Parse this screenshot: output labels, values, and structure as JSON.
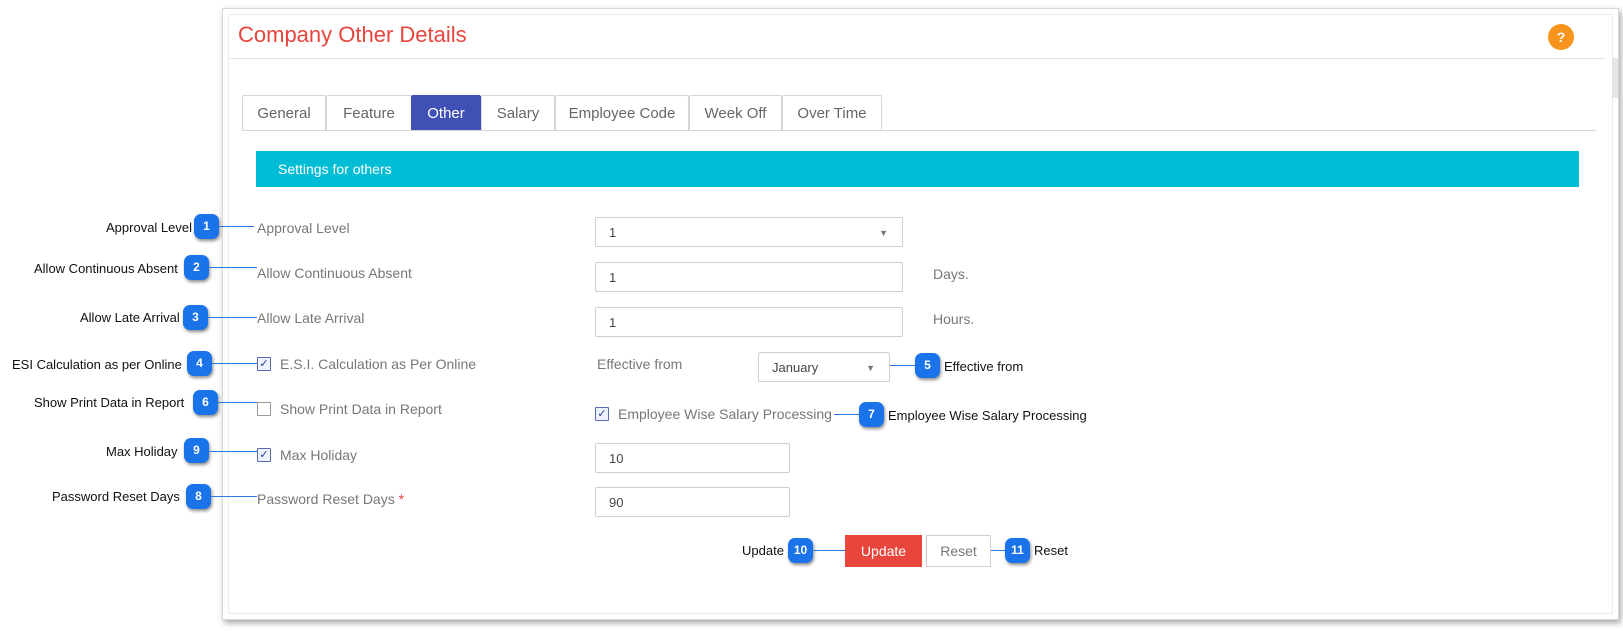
{
  "page": {
    "title": "Company Other Details",
    "help_label": "?"
  },
  "tabs": [
    {
      "label": "General",
      "active": false
    },
    {
      "label": "Feature",
      "active": false
    },
    {
      "label": "Other",
      "active": true
    },
    {
      "label": "Salary",
      "active": false
    },
    {
      "label": "Employee Code",
      "active": false
    },
    {
      "label": "Week Off",
      "active": false
    },
    {
      "label": "Over Time",
      "active": false
    }
  ],
  "section": {
    "title": "Settings for others"
  },
  "form": {
    "approval_level": {
      "label": "Approval Level",
      "value": "1"
    },
    "continuous_absent": {
      "label": "Allow Continuous Absent",
      "value": "1",
      "unit": "Days."
    },
    "late_arrival": {
      "label": "Allow Late Arrival",
      "value": "1",
      "unit": "Hours."
    },
    "esi": {
      "label": "E.S.I. Calculation as Per Online",
      "checked": true
    },
    "effective_from": {
      "label": "Effective from",
      "value": "January"
    },
    "show_print": {
      "label": "Show Print Data in Report",
      "checked": false
    },
    "employee_wise_salary": {
      "label": "Employee Wise Salary Processing",
      "checked": true
    },
    "max_holiday": {
      "label": "Max Holiday",
      "checked": true,
      "value": "10"
    },
    "password_reset_days": {
      "label": "Password Reset Days",
      "required_mark": "*",
      "value": "90"
    },
    "update_label": "Update",
    "reset_label": "Reset",
    "check_glyph": "✓"
  },
  "callouts": [
    {
      "number": "1",
      "text": "Approval Level"
    },
    {
      "number": "2",
      "text": "Allow Continuous Absent"
    },
    {
      "number": "3",
      "text": "Allow Late Arrival"
    },
    {
      "number": "4",
      "text": "ESI Calculation as per Online"
    },
    {
      "number": "5",
      "text": "Effective from"
    },
    {
      "number": "6",
      "text": "Show Print Data in Report"
    },
    {
      "number": "7",
      "text": "Employee Wise Salary Processing"
    },
    {
      "number": "8",
      "text": "Password Reset Days"
    },
    {
      "number": "9",
      "text": "Max Holiday"
    },
    {
      "number": "10",
      "text": "Update"
    },
    {
      "number": "11",
      "text": "Reset"
    }
  ],
  "colors": {
    "title": "#e8453c",
    "active_tab": "#3f51b5",
    "section_bar": "#00bcd4",
    "update_button": "#e8453c",
    "help_button": "#f7941d",
    "callout": "#1a73e8"
  }
}
